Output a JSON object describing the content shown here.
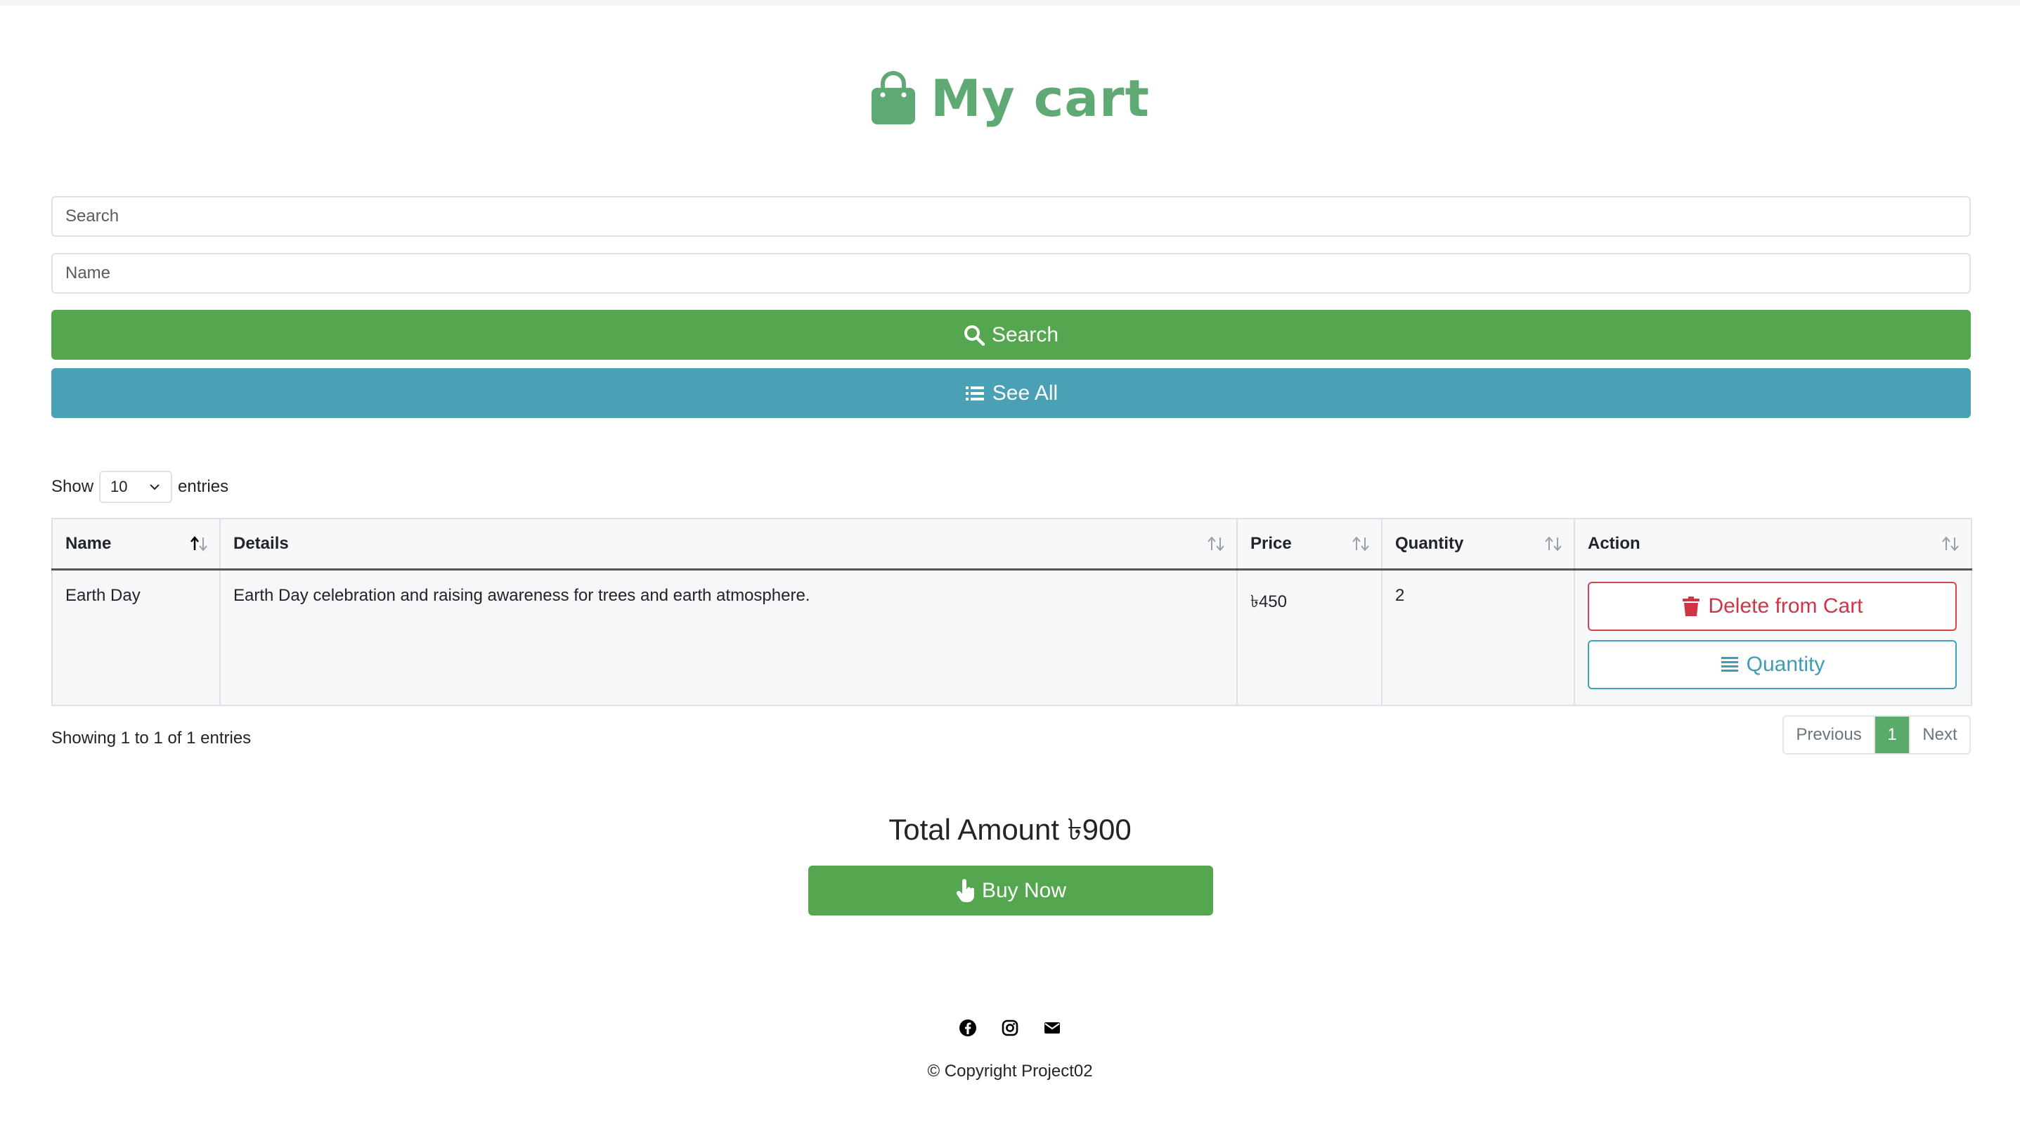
{
  "header": {
    "title": "My cart",
    "icon": "shopping-bag-icon",
    "color": "#5faa74"
  },
  "search": {
    "search_placeholder": "Search",
    "name_placeholder": "Name",
    "search_button": "Search",
    "see_all_button": "See All",
    "search_color": "#54a64f",
    "see_all_color": "#4aa0b5"
  },
  "length": {
    "show": "Show",
    "value": "10",
    "entries": "entries"
  },
  "table": {
    "headers": [
      "Name",
      "Details",
      "Price",
      "Quantity",
      "Action"
    ],
    "sorted_column": "Name",
    "rows": [
      {
        "name": "Earth Day",
        "details": "Earth Day celebration and raising awareness for trees and earth atmosphere.",
        "price": "৳450",
        "quantity": "2",
        "delete_label": "Delete from Cart",
        "quantity_label": "Quantity"
      }
    ]
  },
  "info": "Showing 1 to 1 of 1 entries",
  "pagination": {
    "previous": "Previous",
    "current": "1",
    "next": "Next"
  },
  "total": {
    "text": "Total Amount ৳900"
  },
  "buy": {
    "label": "Buy Now"
  },
  "footer": {
    "icons": [
      "facebook-icon",
      "instagram-icon",
      "envelope-icon"
    ],
    "copyright": "© Copyright Project02"
  }
}
